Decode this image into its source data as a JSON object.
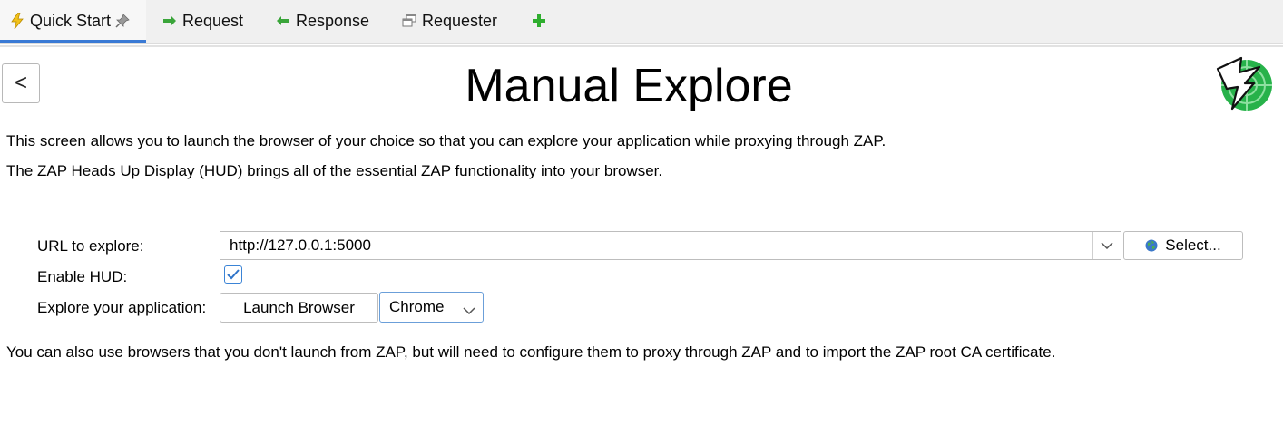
{
  "tabs": [
    {
      "label": "Quick Start",
      "icon": "lightning-icon",
      "active": true,
      "pinned": true
    },
    {
      "label": "Request",
      "icon": "arrow-right-icon"
    },
    {
      "label": "Response",
      "icon": "arrow-left-icon"
    },
    {
      "label": "Requester",
      "icon": "requester-windows-icon"
    },
    {
      "label": "",
      "icon": "add-tab-icon"
    }
  ],
  "colors": {
    "accent": "#3a7ad5",
    "tab_arrow_green": "#3aa53a",
    "logo_green": "#27b24a",
    "lightning_yellow": "#f2c21b"
  },
  "panel": {
    "back_label": "<",
    "title": "Manual Explore",
    "description1": "This screen allows you to launch the browser of your choice so that you can explore your application while proxying through ZAP.",
    "description2": "The ZAP Heads Up Display (HUD) brings all of the essential ZAP functionality into your browser.",
    "footer": "You can also use browsers that you don't launch from ZAP, but will need to configure them to proxy through ZAP and to import the ZAP root CA certificate."
  },
  "form": {
    "url_label": "URL to explore:",
    "url_value": "http://127.0.0.1:5000",
    "select_label": "Select...",
    "hud_label": "Enable HUD:",
    "hud_enabled": true,
    "explore_label": "Explore your application:",
    "launch_label": "Launch Browser",
    "browser_selected": "Chrome"
  }
}
